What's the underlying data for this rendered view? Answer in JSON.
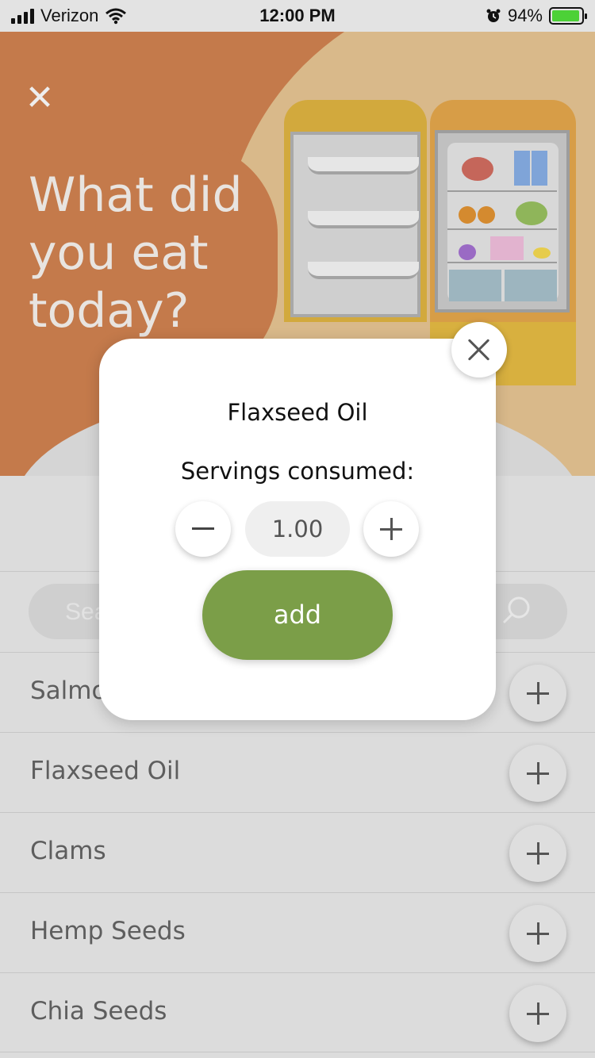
{
  "status_bar": {
    "carrier": "Verizon",
    "time": "12:00 PM",
    "battery": "94%"
  },
  "hero": {
    "title": "What did you eat today?"
  },
  "search": {
    "placeholder": "Sea"
  },
  "food_list": [
    {
      "name": "Salmon"
    },
    {
      "name": "Flaxseed Oil"
    },
    {
      "name": "Clams"
    },
    {
      "name": "Hemp Seeds"
    },
    {
      "name": "Chia Seeds"
    }
  ],
  "modal": {
    "title": "Flaxseed Oil",
    "servings_label": "Servings consumed:",
    "servings_value": "1.00",
    "add_label": "add"
  },
  "colors": {
    "accent_green": "#7b9e48",
    "hero_orange": "#c47a4b"
  },
  "icons": [
    "close-icon",
    "search-icon",
    "plus-icon",
    "minus-icon"
  ]
}
